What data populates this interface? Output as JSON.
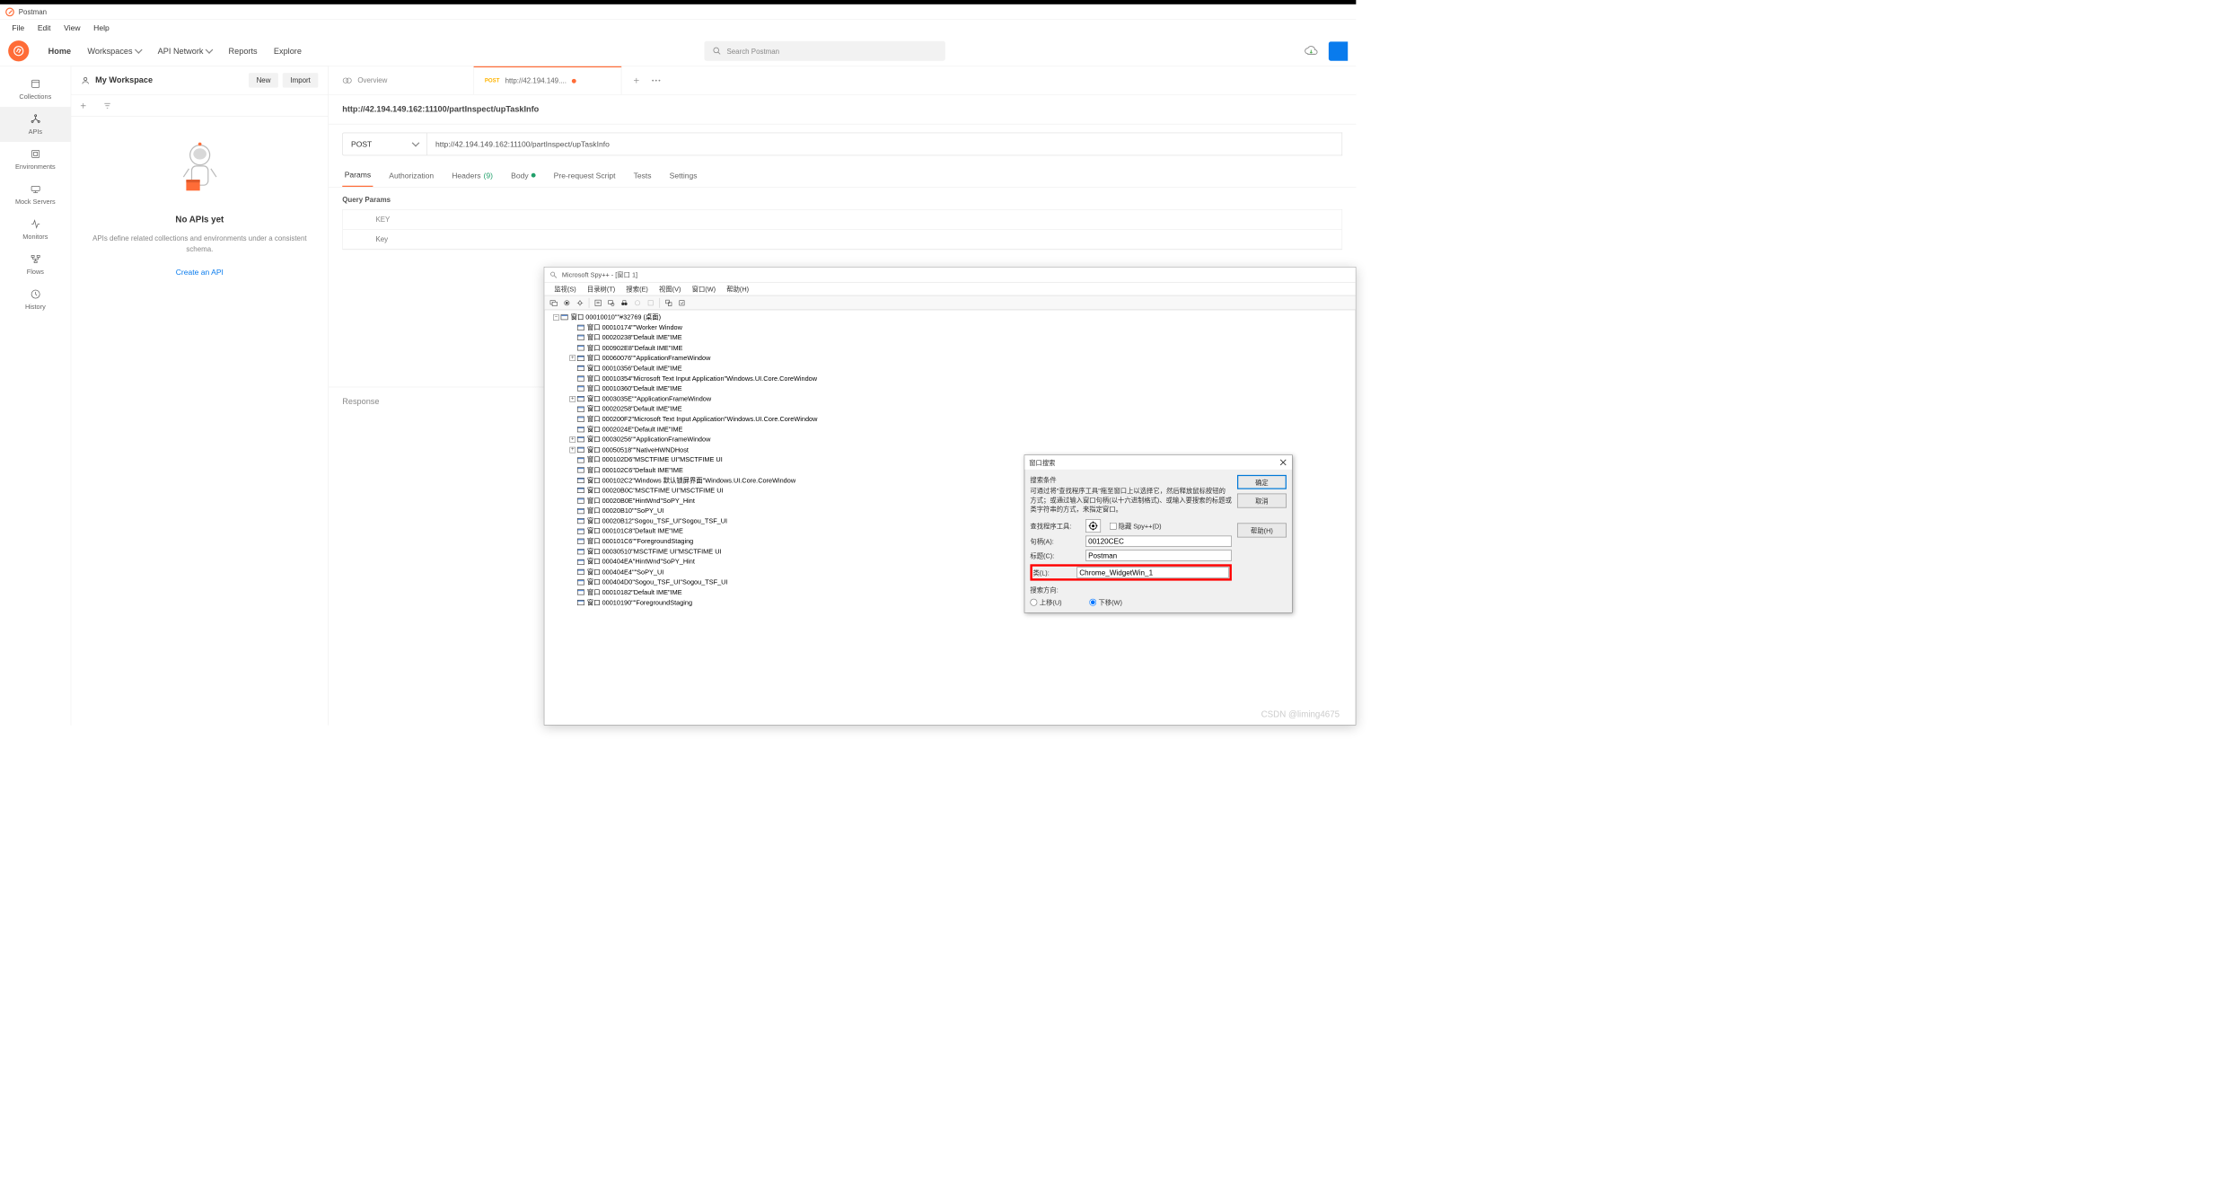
{
  "app_title": "Postman",
  "menu": {
    "file": "File",
    "edit": "Edit",
    "view": "View",
    "help": "Help"
  },
  "nav": {
    "home": "Home",
    "workspaces": "Workspaces",
    "api_network": "API Network",
    "reports": "Reports",
    "explore": "Explore",
    "search_placeholder": "Search Postman"
  },
  "rail": {
    "collections": "Collections",
    "apis": "APIs",
    "environments": "Environments",
    "mock_servers": "Mock Servers",
    "monitors": "Monitors",
    "flows": "Flows",
    "history": "History"
  },
  "side": {
    "workspace_name": "My Workspace",
    "new_btn": "New",
    "import_btn": "Import",
    "empty_title": "No APIs yet",
    "empty_desc": "APIs define related collections and environments under a consistent schema.",
    "create_link": "Create an API"
  },
  "tabs": {
    "overview": "Overview",
    "active": {
      "method": "POST",
      "label": "http://42.194.149...."
    }
  },
  "request": {
    "title": "http://42.194.149.162:11100/partInspect/upTaskInfo",
    "method": "POST",
    "url": "http://42.194.149.162:11100/partInspect/upTaskInfo",
    "subtabs": {
      "params": "Params",
      "auth": "Authorization",
      "headers": "Headers",
      "headers_count": "(9)",
      "body": "Body",
      "prerequest": "Pre-request Script",
      "tests": "Tests",
      "settings": "Settings"
    },
    "query_params_label": "Query Params",
    "key_header": "KEY",
    "key_placeholder": "Key"
  },
  "response_label": "Response",
  "spy": {
    "title": "Microsoft Spy++ - [窗口 1]",
    "menu": {
      "watch": "监视(S)",
      "tree": "目录树(T)",
      "search": "搜索(E)",
      "view": "视图(V)",
      "window": "窗口(W)",
      "help": "帮助(H)"
    },
    "tree": [
      {
        "d": 0,
        "e": "-",
        "t": "窗口 00010010\"\"#32769 (桌面)"
      },
      {
        "d": 1,
        "e": "",
        "t": "窗口 00010174\"\"Worker Window"
      },
      {
        "d": 1,
        "e": "",
        "t": "窗口 00020238\"Default IME\"IME"
      },
      {
        "d": 1,
        "e": "",
        "t": "窗口 000902E8\"Default IME\"IME"
      },
      {
        "d": 1,
        "e": "+",
        "t": "窗口 00060076\"\"ApplicationFrameWindow"
      },
      {
        "d": 1,
        "e": "",
        "t": "窗口 00010356\"Default IME\"IME"
      },
      {
        "d": 1,
        "e": "",
        "t": "窗口 00010354\"Microsoft Text Input Application\"Windows.UI.Core.CoreWindow"
      },
      {
        "d": 1,
        "e": "",
        "t": "窗口 00010360\"Default IME\"IME"
      },
      {
        "d": 1,
        "e": "+",
        "t": "窗口 0003035E\"\"ApplicationFrameWindow"
      },
      {
        "d": 1,
        "e": "",
        "t": "窗口 00020258\"Default IME\"IME"
      },
      {
        "d": 1,
        "e": "",
        "t": "窗口 000200F2\"Microsoft Text Input Application\"Windows.UI.Core.CoreWindow"
      },
      {
        "d": 1,
        "e": "",
        "t": "窗口 0002024E\"Default IME\"IME"
      },
      {
        "d": 1,
        "e": "+",
        "t": "窗口 00030256\"\"ApplicationFrameWindow"
      },
      {
        "d": 1,
        "e": "+",
        "t": "窗口 00050518\"\"NativeHWNDHost"
      },
      {
        "d": 1,
        "e": "",
        "t": "窗口 000102D6\"MSCTFIME UI\"MSCTFIME UI"
      },
      {
        "d": 1,
        "e": "",
        "t": "窗口 000102C6\"Default IME\"IME"
      },
      {
        "d": 1,
        "e": "",
        "t": "窗口 000102C2\"Windows 默认锁屏界面\"Windows.UI.Core.CoreWindow"
      },
      {
        "d": 1,
        "e": "",
        "t": "窗口 00020B0C\"MSCTFIME UI\"MSCTFIME UI"
      },
      {
        "d": 1,
        "e": "",
        "t": "窗口 00020B0E\"HintWnd\"SoPY_Hint"
      },
      {
        "d": 1,
        "e": "",
        "t": "窗口 00020B10\"\"SoPY_UI"
      },
      {
        "d": 1,
        "e": "",
        "t": "窗口 00020B12\"Sogou_TSF_UI\"Sogou_TSF_UI"
      },
      {
        "d": 1,
        "e": "",
        "t": "窗口 000101C8\"Default IME\"IME"
      },
      {
        "d": 1,
        "e": "",
        "t": "窗口 000101C6\"\"ForegroundStaging"
      },
      {
        "d": 1,
        "e": "",
        "t": "窗口 00030510\"MSCTFIME UI\"MSCTFIME UI"
      },
      {
        "d": 1,
        "e": "",
        "t": "窗口 000404EA\"HintWnd\"SoPY_Hint"
      },
      {
        "d": 1,
        "e": "",
        "t": "窗口 000404E4\"\"SoPY_UI"
      },
      {
        "d": 1,
        "e": "",
        "t": "窗口 000404D0\"Sogou_TSF_UI\"Sogou_TSF_UI"
      },
      {
        "d": 1,
        "e": "",
        "t": "窗口 00010182\"Default IME\"IME"
      },
      {
        "d": 1,
        "e": "",
        "t": "窗口 00010190\"\"ForegroundStaging"
      }
    ]
  },
  "search_dialog": {
    "title": "窗口搜索",
    "group_label": "搜索条件",
    "hint": "可通过将\"查找程序工具\"拖至窗口上以选择它，然后释放鼠标按钮的方式；或通过输入窗口句柄(以十六进制格式)、或输入要搜索的标题或类字符串的方式，来指定窗口。",
    "finder_label": "查找程序工具:",
    "hide_spy_label": "隐藏 Spy++(D)",
    "handle_label": "句柄(A):",
    "handle_value": "00120CEC",
    "caption_label": "标题(C):",
    "caption_value": "Postman",
    "class_label": "类(L):",
    "class_value": "Chrome_WidgetWin_1",
    "direction_label": "搜索方向:",
    "up_label": "上移(U)",
    "down_label": "下移(W)",
    "ok": "确定",
    "cancel": "取消",
    "help": "帮助(H)"
  },
  "watermark": "CSDN @liming4675"
}
